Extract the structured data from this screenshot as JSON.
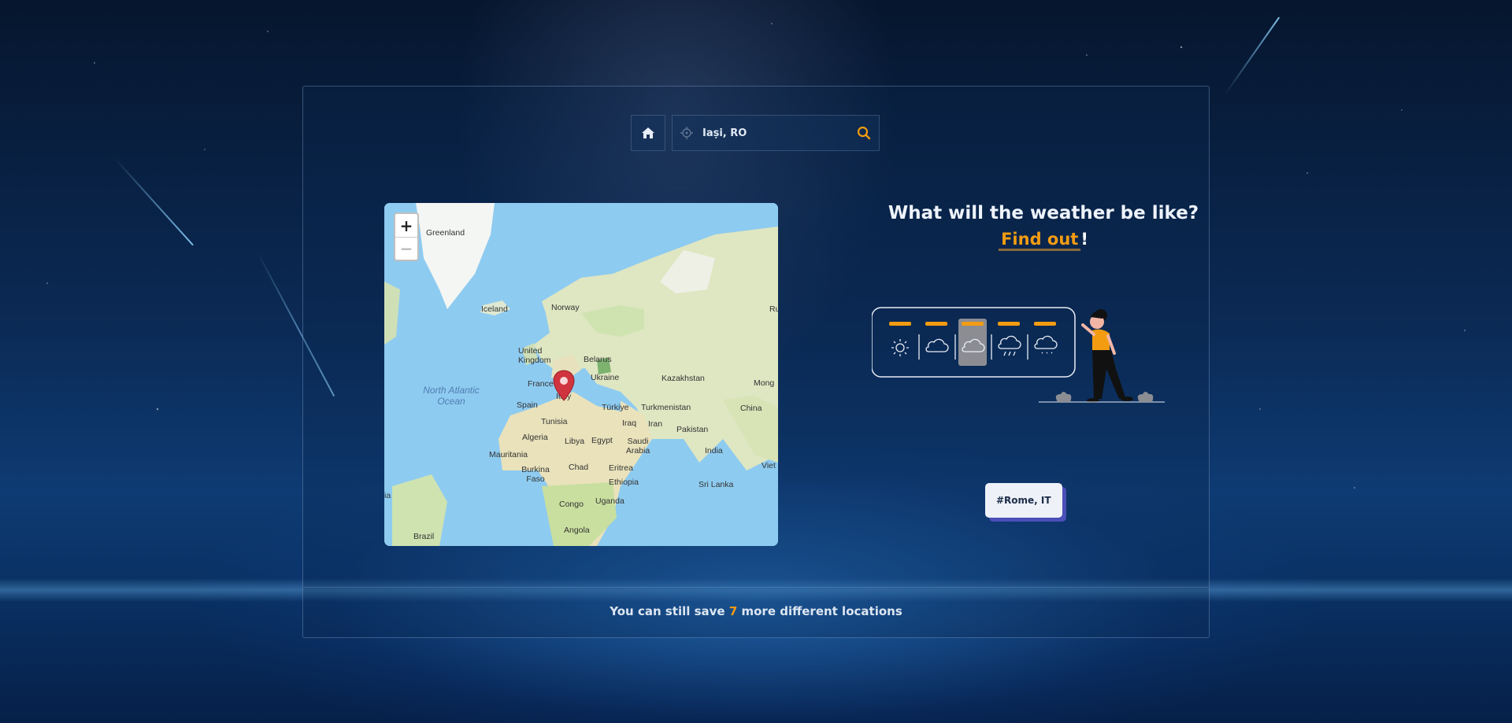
{
  "search": {
    "value": "Iași, RO"
  },
  "map": {
    "zoom_in_label": "+",
    "zoom_out_label": "−",
    "labels": {
      "greenland": "Greenland",
      "iceland": "Iceland",
      "norway": "Norway",
      "united_kingdom": "United Kingdom",
      "belarus": "Belarus",
      "ukraine": "Ukraine",
      "kazakhstan": "Kazakhstan",
      "france": "France",
      "italy": "Italy",
      "north_atlantic_ocean": "North Atlantic Ocean",
      "spain": "Spain",
      "turkiye": "Türkiye",
      "turkmenistan": "Turkmenistan",
      "mongolia": "Mong",
      "china": "China",
      "tunisia": "Tunisia",
      "iraq": "Iraq",
      "iran": "Iran",
      "pakistan": "Pakistan",
      "algeria": "Algeria",
      "libya": "Libya",
      "egypt": "Egypt",
      "saudi_arabia": "Saudi Arabia",
      "india": "India",
      "mauritania": "Mauritania",
      "burkina_faso": "Burkina Faso",
      "chad": "Chad",
      "eritrea": "Eritrea",
      "ethiopia": "Ethiopia",
      "sri_lanka": "Sri Lanka",
      "congo": "Congo",
      "uganda": "Uganda",
      "angola": "Angola",
      "brazil": "Brazil",
      "ru": "Ru",
      "viet": "Viet",
      "ia": "ia"
    }
  },
  "hero": {
    "title": "What will the weather be like?",
    "find_out": "Find out",
    "exclamation": "!"
  },
  "saved_city": "#Rome, IT",
  "footer": {
    "prefix": "You can still save ",
    "count": "7",
    "suffix": " more different locations"
  },
  "colors": {
    "accent": "#f39c12",
    "tag_shadow": "#4b4fb8"
  }
}
